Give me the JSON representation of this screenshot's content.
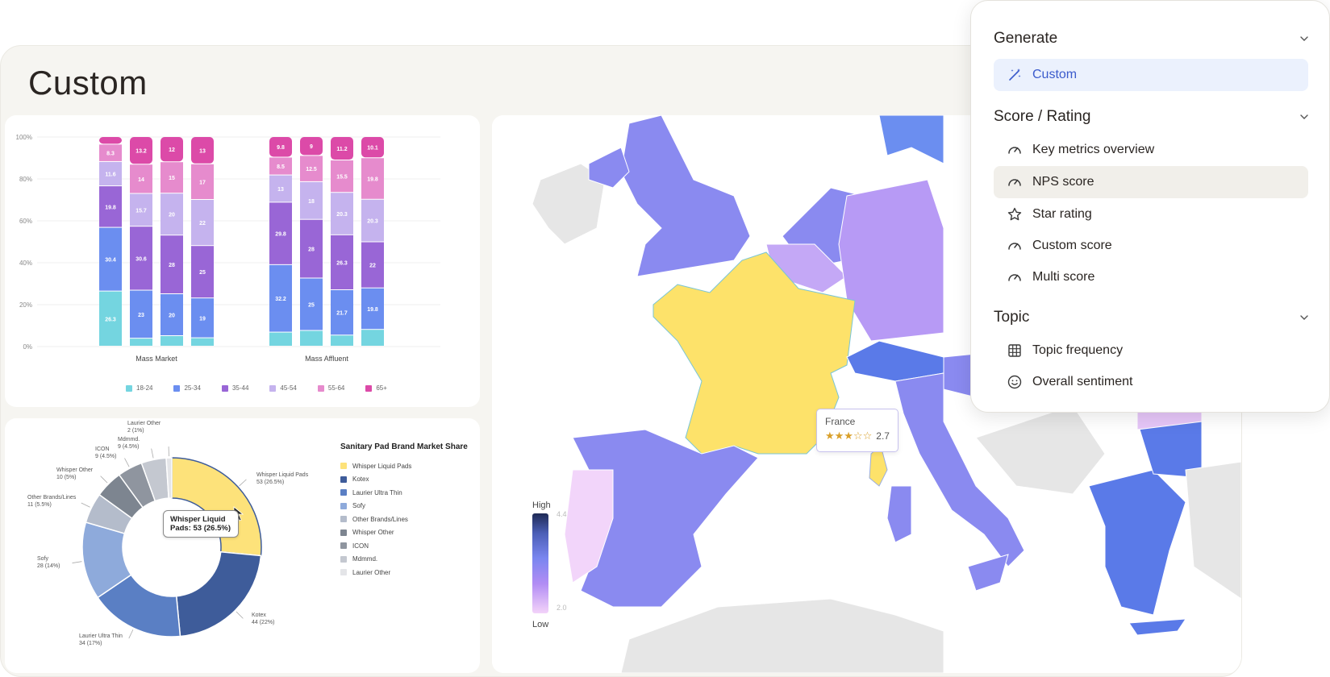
{
  "page": {
    "title": "Custom"
  },
  "bar_chart": {
    "chart_data": {
      "type": "bar",
      "stacked": true,
      "groups": [
        "Mass Market",
        "Mass Affluent"
      ],
      "y_ticks": [
        "0%",
        "20%",
        "40%",
        "60%",
        "80%",
        "100%"
      ],
      "ylim": [
        0,
        100
      ],
      "series_names": [
        "18-24",
        "25-34",
        "35-44",
        "45-54",
        "55-64",
        "65+"
      ],
      "series_colors": [
        "#74d5e0",
        "#6b8ef0",
        "#9966d6",
        "#c5b3ee",
        "#e68bcd",
        "#dc4aa8"
      ],
      "legend_position": "bottom",
      "bars": [
        {
          "group": 0,
          "values": [
            26.3,
            30.4,
            19.8,
            11.6,
            8.3,
            3.6
          ],
          "labels": [
            "26.3",
            "30.4",
            "19.8",
            "11.6",
            "8.3",
            ""
          ]
        },
        {
          "group": 0,
          "values": [
            3.8,
            23,
            30.6,
            15.7,
            14,
            13.2
          ],
          "labels": [
            "",
            "23",
            "30.6",
            "15.7",
            "14",
            "13.2"
          ]
        },
        {
          "group": 0,
          "values": [
            5,
            20,
            28,
            20,
            15,
            12
          ],
          "labels": [
            "",
            "20",
            "28",
            "20",
            "15",
            "12"
          ]
        },
        {
          "group": 0,
          "values": [
            4,
            19,
            25,
            22,
            17,
            13
          ],
          "labels": [
            "",
            "19",
            "25",
            "22",
            "17",
            "13"
          ]
        },
        {
          "group": 1,
          "values": [
            6.7,
            32.2,
            29.8,
            13,
            8.5,
            9.8
          ],
          "labels": [
            "",
            "32.2",
            "29.8",
            "13",
            "8.5",
            "9.8"
          ]
        },
        {
          "group": 1,
          "values": [
            7.5,
            25,
            28,
            18,
            12.5,
            9
          ],
          "labels": [
            "",
            "25",
            "28",
            "18",
            "12.5",
            "9"
          ]
        },
        {
          "group": 1,
          "values": [
            5.3,
            21.7,
            26.3,
            20.3,
            15.5,
            11.2
          ],
          "labels": [
            "",
            "21.7",
            "26.3",
            "20.3",
            "15.5",
            "11.2"
          ]
        },
        {
          "group": 1,
          "values": [
            8,
            19.8,
            22,
            20.3,
            19.8,
            10.1
          ],
          "labels": [
            "",
            "19.8",
            "22",
            "20.3",
            "19.8",
            "10.1"
          ]
        }
      ]
    }
  },
  "donut_chart": {
    "legend_title": "Sanitary Pad Brand Market Share",
    "tooltip": "Whisper Liquid Pads: 53 (26.5%)",
    "chart_data": {
      "type": "pie",
      "donut": true,
      "title": "Sanitary Pad Brand Market Share",
      "slices": [
        {
          "name": "Whisper Liquid Pads",
          "value": 53,
          "label": "Whisper Liquid Pads",
          "sub": "53 (26.5%)",
          "color": "#fde27a"
        },
        {
          "name": "Kotex",
          "value": 44,
          "label": "Kotex",
          "sub": "44 (22%)",
          "color": "#3e5c9a"
        },
        {
          "name": "Laurier Ultra Thin",
          "value": 34,
          "label": "Laurier Ultra Thin",
          "sub": "34 (17%)",
          "color": "#5a7fc4"
        },
        {
          "name": "Sofy",
          "value": 28,
          "label": "Sofy",
          "sub": "28 (14%)",
          "color": "#8eaadb"
        },
        {
          "name": "Other Brands/Lines",
          "value": 11,
          "label": "Other Brands/Lines",
          "sub": "11 (5.5%)",
          "color": "#b4bccb"
        },
        {
          "name": "Whisper Other",
          "value": 10,
          "label": "Whisper Other",
          "sub": "10 (5%)",
          "color": "#7d8590"
        },
        {
          "name": "ICON",
          "value": 9,
          "label": "ICON",
          "sub": "9 (4.5%)",
          "color": "#8f959f"
        },
        {
          "name": "Mdmmd.",
          "value": 9,
          "label": "Mdmmd.",
          "sub": "9 (4.5%)",
          "color": "#c4c8d0"
        },
        {
          "name": "Laurier Other",
          "value": 2,
          "label": "Laurier Other",
          "sub": "2 (1%)",
          "color": "#e4e5e8"
        }
      ]
    }
  },
  "map": {
    "tooltip": {
      "country": "France",
      "stars": "★★★☆☆",
      "rating": "2.7"
    },
    "legend": {
      "high": "High",
      "low": "Low",
      "high_value": "4.4",
      "low_value": "2.0"
    },
    "colors": {
      "france": "#fde26a",
      "purple_light": "#c4a8f6",
      "purple": "#8a8af0",
      "blue": "#5a7ae8",
      "pink": "#f2d5fa",
      "grey": "#e6e6e6"
    }
  },
  "menu": {
    "sections": [
      {
        "title": "Generate",
        "items": [
          {
            "label": "Custom",
            "icon": "magic-wand-icon",
            "state": "selected"
          }
        ]
      },
      {
        "title": "Score / Rating",
        "items": [
          {
            "label": "Key metrics overview",
            "icon": "gauge-icon",
            "state": ""
          },
          {
            "label": "NPS score",
            "icon": "gauge-icon",
            "state": "hover"
          },
          {
            "label": "Star rating",
            "icon": "star-icon",
            "state": ""
          },
          {
            "label": "Custom score",
            "icon": "gauge-icon",
            "state": ""
          },
          {
            "label": "Multi score",
            "icon": "gauge-icon",
            "state": ""
          }
        ]
      },
      {
        "title": "Topic",
        "items": [
          {
            "label": "Topic frequency",
            "icon": "grid-icon",
            "state": ""
          },
          {
            "label": "Overall sentiment",
            "icon": "smiley-icon",
            "state": ""
          }
        ]
      }
    ],
    "accent_color": "#3b5bcc"
  }
}
